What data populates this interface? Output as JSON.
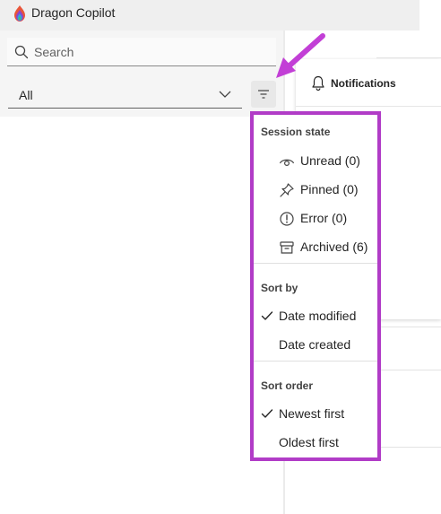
{
  "app": {
    "title": "Dragon Copilot"
  },
  "search": {
    "placeholder": "Search",
    "value": ""
  },
  "filter": {
    "selected": "All"
  },
  "notifications": {
    "title": "Notifications"
  },
  "menu": {
    "session_state": {
      "heading": "Session state",
      "items": [
        {
          "label": "Unread (0)",
          "icon": "eye-icon"
        },
        {
          "label": "Pinned (0)",
          "icon": "pin-icon"
        },
        {
          "label": "Error (0)",
          "icon": "error-icon"
        },
        {
          "label": "Archived (6)",
          "icon": "archive-icon"
        }
      ]
    },
    "sort_by": {
      "heading": "Sort by",
      "items": [
        {
          "label": "Date modified",
          "checked": true
        },
        {
          "label": "Date created",
          "checked": false
        }
      ]
    },
    "sort_order": {
      "heading": "Sort order",
      "items": [
        {
          "label": "Newest first",
          "checked": true
        },
        {
          "label": "Oldest first",
          "checked": false
        }
      ]
    }
  },
  "colors": {
    "highlight_border": "#b13cc7",
    "annotation_arrow": "#c23fd6",
    "header_bg": "#efefef",
    "panel_bg": "#f5f5f5"
  }
}
